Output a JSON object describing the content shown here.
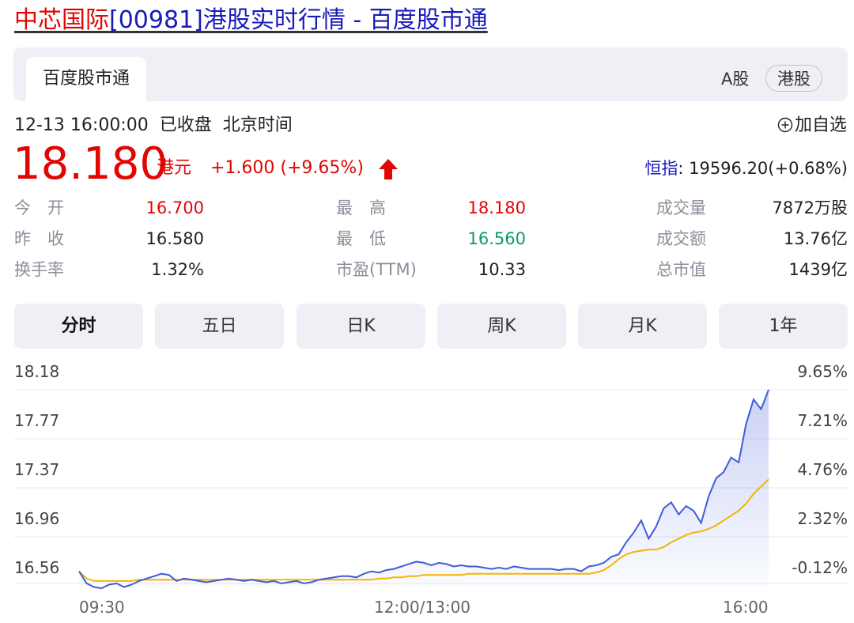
{
  "page": {
    "title_stock": "中芯国际",
    "title_rest": "[00981]港股实时行情 - 百度股市通"
  },
  "tabs_top": {
    "active": "百度股市通"
  },
  "market_toggle": {
    "a": "A股",
    "hk": "港股"
  },
  "status": {
    "datetime": "12-13 16:00:00",
    "state": "已收盘",
    "tz": "北京时间"
  },
  "favorite": {
    "label": "加自选"
  },
  "quote": {
    "price": "18.180",
    "currency": "港元",
    "change": "+1.600 (+9.65%)",
    "index_name": "恒指",
    "index_value": ": 19596.20(+0.68%)"
  },
  "stats": [
    {
      "label": "今　开",
      "value": "16.700",
      "color": "red"
    },
    {
      "label": "最　高",
      "value": "18.180",
      "color": "red"
    },
    {
      "label": "成交量",
      "value": "7872万股",
      "color": "dark"
    },
    {
      "label": "昨　收",
      "value": "16.580",
      "color": "dark"
    },
    {
      "label": "最　低",
      "value": "16.560",
      "color": "green"
    },
    {
      "label": "成交额",
      "value": "13.76亿",
      "color": "dark"
    },
    {
      "label": "换手率",
      "value": "1.32%",
      "color": "dark"
    },
    {
      "label": "市盈(TTM)",
      "value": "10.33",
      "color": "dark"
    },
    {
      "label": "总市值",
      "value": "1439亿",
      "color": "dark"
    }
  ],
  "period_tabs": [
    "分时",
    "五日",
    "日K",
    "周K",
    "月K",
    "1年"
  ],
  "colors": {
    "up": "#e10602",
    "down": "#0c9a6a",
    "price_line": "#3f5bd8",
    "avg_line": "#f5b400",
    "link": "#1a1ab9"
  },
  "chart_data": {
    "type": "line",
    "y_left_ticks": [
      "18.18",
      "17.77",
      "17.37",
      "16.96",
      "16.56"
    ],
    "y_right_ticks": [
      "9.65%",
      "7.21%",
      "4.76%",
      "2.32%",
      "-0.12%"
    ],
    "x_ticks": [
      "09:30",
      "12:00/13:00",
      "16:00"
    ],
    "ylim": [
      16.56,
      18.18
    ],
    "prev_close": 16.58,
    "series": [
      {
        "values": [
          16.68,
          16.58,
          16.55,
          16.54,
          16.57,
          16.58,
          16.55,
          16.57,
          16.6,
          16.62,
          16.64,
          16.66,
          16.65,
          16.6,
          16.62,
          16.61,
          16.6,
          16.59,
          16.6,
          16.61,
          16.62,
          16.61,
          16.6,
          16.61,
          16.6,
          16.59,
          16.6,
          16.58,
          16.59,
          16.6,
          16.58,
          16.59,
          16.61,
          16.62,
          16.63,
          16.64,
          16.64,
          16.63,
          16.66,
          16.68,
          16.67,
          16.69,
          16.7,
          16.72,
          16.74,
          16.76,
          16.75,
          16.73,
          16.75,
          16.74,
          16.72,
          16.73,
          16.72,
          16.72,
          16.71,
          16.7,
          16.71,
          16.7,
          16.72,
          16.71,
          16.7,
          16.7,
          16.7,
          16.7,
          16.69,
          16.7,
          16.7,
          16.68,
          16.72,
          16.73,
          16.75,
          16.8,
          16.82,
          16.92,
          17.0,
          17.1,
          16.95,
          17.05,
          17.2,
          17.25,
          17.15,
          17.22,
          17.18,
          17.08,
          17.3,
          17.45,
          17.5,
          17.62,
          17.58,
          17.9,
          18.1,
          18.02,
          18.18
        ]
      },
      {
        "values": [
          16.68,
          16.62,
          16.6,
          16.6,
          16.6,
          16.6,
          16.6,
          16.6,
          16.61,
          16.61,
          16.61,
          16.61,
          16.61,
          16.61,
          16.61,
          16.61,
          16.61,
          16.61,
          16.61,
          16.61,
          16.61,
          16.61,
          16.61,
          16.61,
          16.61,
          16.61,
          16.61,
          16.61,
          16.61,
          16.61,
          16.61,
          16.61,
          16.61,
          16.61,
          16.61,
          16.61,
          16.61,
          16.61,
          16.61,
          16.61,
          16.62,
          16.62,
          16.63,
          16.63,
          16.64,
          16.64,
          16.65,
          16.65,
          16.65,
          16.65,
          16.65,
          16.65,
          16.66,
          16.66,
          16.66,
          16.66,
          16.66,
          16.66,
          16.66,
          16.66,
          16.66,
          16.66,
          16.66,
          16.66,
          16.66,
          16.66,
          16.66,
          16.66,
          16.66,
          16.67,
          16.69,
          16.73,
          16.78,
          16.82,
          16.84,
          16.85,
          16.86,
          16.86,
          16.88,
          16.92,
          16.95,
          16.98,
          17.0,
          17.01,
          17.03,
          17.06,
          17.1,
          17.14,
          17.18,
          17.24,
          17.32,
          17.38,
          17.44
        ]
      }
    ]
  }
}
